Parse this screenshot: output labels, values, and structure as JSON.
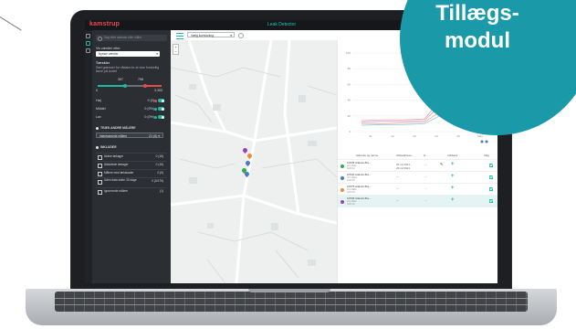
{
  "app": {
    "brand": "kamstrup",
    "title": "Leak Detector"
  },
  "sidebar": {
    "search_placeholder": "Søg efter adresse eller måler",
    "filter_label": "Vis værdier efter:",
    "filter_value": "Nyeste værdier",
    "threshold_title": "Tærskler",
    "threshold_desc": "Sæt grænser for rådata for at vise forskellig farve på kortet",
    "slider_low": "0",
    "slider_high": "3.300",
    "slider_mark_teal": "397",
    "slider_mark_red": "798",
    "rows": [
      {
        "label": "Høj",
        "value": "0 (0)",
        "color": "#e54b4b"
      },
      {
        "label": "Middel",
        "value": "0 (0%)",
        "color": "#f0a030"
      },
      {
        "label": "Lav",
        "value": "0 (0%)",
        "color": "#1fb8a7"
      }
    ],
    "section_selected": "TRÆK ANDRE MÅLERE",
    "selected_value": "Interesserede målere",
    "selected_count": "21 (0) ▾",
    "section_include": "INKLUDER",
    "include_items": [
      {
        "label": "Aktive lækager",
        "count": "0 (16)"
      },
      {
        "label": "Afsluttede lækager",
        "count": "0 (16)"
      },
      {
        "label": "Målere med lækskader",
        "count": "0 (0)"
      },
      {
        "label": "Uden data siden 30 dage",
        "count": "0 (0/175)"
      },
      {
        "label": "Ignorerede målere",
        "count": "(1)"
      }
    ]
  },
  "toolbar": {
    "layer_select": "Vælg kortvisning",
    "tabs": [
      "Kort",
      "Liste"
    ]
  },
  "chart_data": {
    "type": "line",
    "ylim": [
      0,
      100
    ],
    "yticks": [
      "0",
      "20",
      "40",
      "60",
      "80",
      "100"
    ],
    "xticks": [
      "21",
      "22",
      "23",
      "24",
      "25",
      "May"
    ],
    "series": [
      {
        "color": "#e8a0a8",
        "values": [
          14,
          15,
          15,
          16,
          48,
          70,
          82
        ]
      },
      {
        "color": "#d0a0d8",
        "values": [
          12,
          13,
          13,
          14,
          40,
          58,
          64
        ]
      },
      {
        "color": "#f0b080",
        "values": [
          10,
          10,
          11,
          12,
          30,
          44,
          50
        ]
      },
      {
        "color": "#90c8f0",
        "values": [
          8,
          9,
          9,
          10,
          24,
          34,
          38
        ]
      }
    ]
  },
  "table": {
    "headers": [
      "Adresse og navne",
      "Afstand/resu...",
      "H...",
      "Indikatur",
      "Valg"
    ],
    "rows": [
      {
        "addr": "10535 Atlantis Bre...",
        "sub1": "Område",
        "sub2": "A2010",
        "dist": "20.12.2021...",
        "dist2": "20.12.2021",
        "h": "—",
        "color": "#2eaa4f",
        "selected": false
      },
      {
        "addr": "10540 Atlantis Bre...",
        "sub1": "Område",
        "sub2": "A2010",
        "dist": "—",
        "dist2": "",
        "h": "—",
        "color": "#4a78c8",
        "selected": false
      },
      {
        "addr": "10575 Atlantis Bre...",
        "sub1": "Område",
        "sub2": "A2010",
        "dist": "—",
        "dist2": "",
        "h": "—",
        "color": "#f08a30",
        "selected": false
      },
      {
        "addr": "10535 Atlantis Bre...",
        "sub1": "Område",
        "sub2": "A2010",
        "dist": "—",
        "dist2": "",
        "h": "—",
        "color": "#9a3cc8",
        "selected": true
      }
    ]
  },
  "badge": {
    "line1": "Tillægs-",
    "line2": "modul",
    "color": "#1a9aa8"
  }
}
